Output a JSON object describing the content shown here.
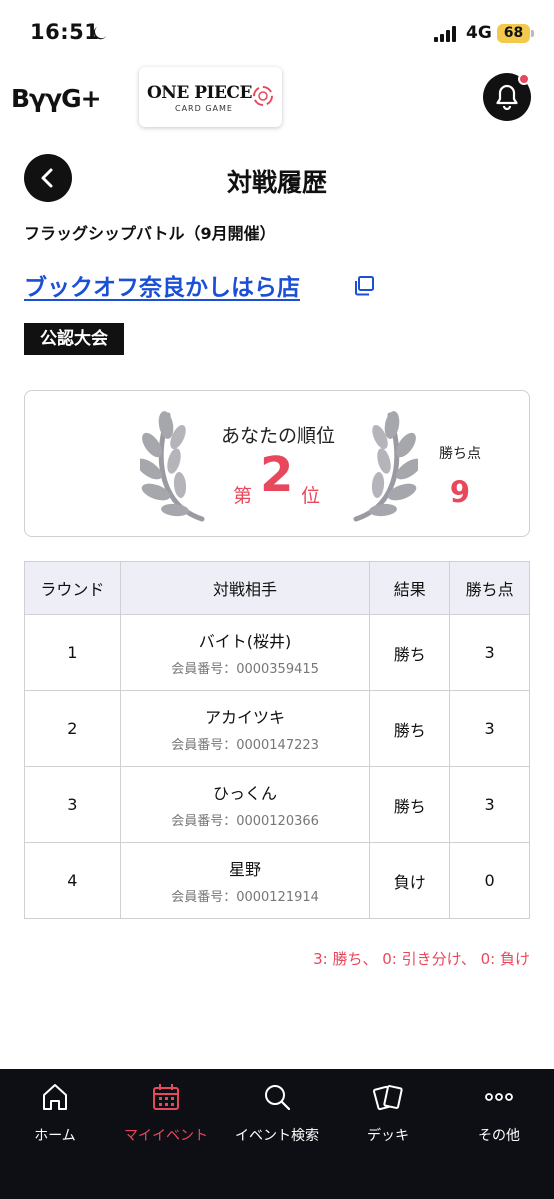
{
  "status_bar": {
    "time": "16:51",
    "network": "4G",
    "battery": "68"
  },
  "header": {
    "brand": "BγγG+",
    "game_logo_title": "ONE PIECE",
    "game_logo_sub": "CARD GAME"
  },
  "page": {
    "title": "対戦履歴",
    "event_name": "フラッグシップバトル（9月開催）",
    "store_name": "ブックオフ奈良かしはら店",
    "badge": "公認大会"
  },
  "rank_card": {
    "label": "あなたの順位",
    "prefix": "第",
    "rank": "2",
    "suffix": "位",
    "points_label": "勝ち点",
    "points": "9"
  },
  "table": {
    "headers": [
      "ラウンド",
      "対戦相手",
      "結果",
      "勝ち点"
    ],
    "rows": [
      {
        "round": "1",
        "opponent": "バイト(桜井)",
        "member": "会員番号：0000359415",
        "result": "勝ち",
        "points": "3"
      },
      {
        "round": "2",
        "opponent": "アカイツキ",
        "member": "会員番号：0000147223",
        "result": "勝ち",
        "points": "3"
      },
      {
        "round": "3",
        "opponent": "ひっくん",
        "member": "会員番号：0000120366",
        "result": "勝ち",
        "points": "3"
      },
      {
        "round": "4",
        "opponent": "星野",
        "member": "会員番号：0000121914",
        "result": "負け",
        "points": "0"
      }
    ]
  },
  "legend_note": "3: 勝ち、 0: 引き分け、 0: 負け",
  "bottom_nav": [
    {
      "label": "ホーム",
      "icon": "home-icon",
      "active": false
    },
    {
      "label": "マイイベント",
      "icon": "calendar-icon",
      "active": true
    },
    {
      "label": "イベント検索",
      "icon": "search-icon",
      "active": false
    },
    {
      "label": "デッキ",
      "icon": "cards-icon",
      "active": false
    },
    {
      "label": "その他",
      "icon": "more-icon",
      "active": false
    }
  ],
  "colors": {
    "accent": "#e8485c",
    "link": "#1a4fd6",
    "dark": "#111111",
    "nav_bg": "#0e0f14"
  }
}
